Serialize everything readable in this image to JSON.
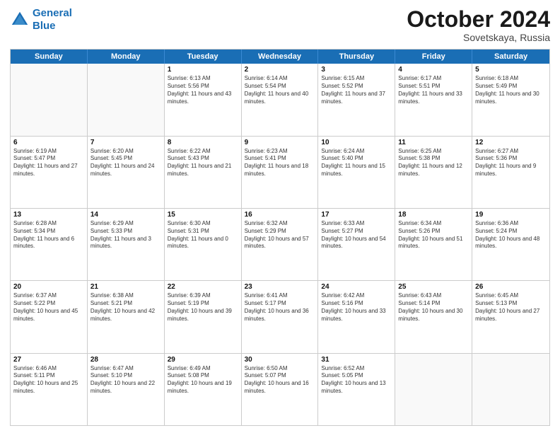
{
  "header": {
    "logo_line1": "General",
    "logo_line2": "Blue",
    "month": "October 2024",
    "location": "Sovetskaya, Russia"
  },
  "weekdays": [
    "Sunday",
    "Monday",
    "Tuesday",
    "Wednesday",
    "Thursday",
    "Friday",
    "Saturday"
  ],
  "rows": [
    [
      {
        "day": "",
        "sunrise": "",
        "sunset": "",
        "daylight": "",
        "empty": true
      },
      {
        "day": "",
        "sunrise": "",
        "sunset": "",
        "daylight": "",
        "empty": true
      },
      {
        "day": "1",
        "sunrise": "Sunrise: 6:13 AM",
        "sunset": "Sunset: 5:56 PM",
        "daylight": "Daylight: 11 hours and 43 minutes."
      },
      {
        "day": "2",
        "sunrise": "Sunrise: 6:14 AM",
        "sunset": "Sunset: 5:54 PM",
        "daylight": "Daylight: 11 hours and 40 minutes."
      },
      {
        "day": "3",
        "sunrise": "Sunrise: 6:15 AM",
        "sunset": "Sunset: 5:52 PM",
        "daylight": "Daylight: 11 hours and 37 minutes."
      },
      {
        "day": "4",
        "sunrise": "Sunrise: 6:17 AM",
        "sunset": "Sunset: 5:51 PM",
        "daylight": "Daylight: 11 hours and 33 minutes."
      },
      {
        "day": "5",
        "sunrise": "Sunrise: 6:18 AM",
        "sunset": "Sunset: 5:49 PM",
        "daylight": "Daylight: 11 hours and 30 minutes."
      }
    ],
    [
      {
        "day": "6",
        "sunrise": "Sunrise: 6:19 AM",
        "sunset": "Sunset: 5:47 PM",
        "daylight": "Daylight: 11 hours and 27 minutes."
      },
      {
        "day": "7",
        "sunrise": "Sunrise: 6:20 AM",
        "sunset": "Sunset: 5:45 PM",
        "daylight": "Daylight: 11 hours and 24 minutes."
      },
      {
        "day": "8",
        "sunrise": "Sunrise: 6:22 AM",
        "sunset": "Sunset: 5:43 PM",
        "daylight": "Daylight: 11 hours and 21 minutes."
      },
      {
        "day": "9",
        "sunrise": "Sunrise: 6:23 AM",
        "sunset": "Sunset: 5:41 PM",
        "daylight": "Daylight: 11 hours and 18 minutes."
      },
      {
        "day": "10",
        "sunrise": "Sunrise: 6:24 AM",
        "sunset": "Sunset: 5:40 PM",
        "daylight": "Daylight: 11 hours and 15 minutes."
      },
      {
        "day": "11",
        "sunrise": "Sunrise: 6:25 AM",
        "sunset": "Sunset: 5:38 PM",
        "daylight": "Daylight: 11 hours and 12 minutes."
      },
      {
        "day": "12",
        "sunrise": "Sunrise: 6:27 AM",
        "sunset": "Sunset: 5:36 PM",
        "daylight": "Daylight: 11 hours and 9 minutes."
      }
    ],
    [
      {
        "day": "13",
        "sunrise": "Sunrise: 6:28 AM",
        "sunset": "Sunset: 5:34 PM",
        "daylight": "Daylight: 11 hours and 6 minutes."
      },
      {
        "day": "14",
        "sunrise": "Sunrise: 6:29 AM",
        "sunset": "Sunset: 5:33 PM",
        "daylight": "Daylight: 11 hours and 3 minutes."
      },
      {
        "day": "15",
        "sunrise": "Sunrise: 6:30 AM",
        "sunset": "Sunset: 5:31 PM",
        "daylight": "Daylight: 11 hours and 0 minutes."
      },
      {
        "day": "16",
        "sunrise": "Sunrise: 6:32 AM",
        "sunset": "Sunset: 5:29 PM",
        "daylight": "Daylight: 10 hours and 57 minutes."
      },
      {
        "day": "17",
        "sunrise": "Sunrise: 6:33 AM",
        "sunset": "Sunset: 5:27 PM",
        "daylight": "Daylight: 10 hours and 54 minutes."
      },
      {
        "day": "18",
        "sunrise": "Sunrise: 6:34 AM",
        "sunset": "Sunset: 5:26 PM",
        "daylight": "Daylight: 10 hours and 51 minutes."
      },
      {
        "day": "19",
        "sunrise": "Sunrise: 6:36 AM",
        "sunset": "Sunset: 5:24 PM",
        "daylight": "Daylight: 10 hours and 48 minutes."
      }
    ],
    [
      {
        "day": "20",
        "sunrise": "Sunrise: 6:37 AM",
        "sunset": "Sunset: 5:22 PM",
        "daylight": "Daylight: 10 hours and 45 minutes."
      },
      {
        "day": "21",
        "sunrise": "Sunrise: 6:38 AM",
        "sunset": "Sunset: 5:21 PM",
        "daylight": "Daylight: 10 hours and 42 minutes."
      },
      {
        "day": "22",
        "sunrise": "Sunrise: 6:39 AM",
        "sunset": "Sunset: 5:19 PM",
        "daylight": "Daylight: 10 hours and 39 minutes."
      },
      {
        "day": "23",
        "sunrise": "Sunrise: 6:41 AM",
        "sunset": "Sunset: 5:17 PM",
        "daylight": "Daylight: 10 hours and 36 minutes."
      },
      {
        "day": "24",
        "sunrise": "Sunrise: 6:42 AM",
        "sunset": "Sunset: 5:16 PM",
        "daylight": "Daylight: 10 hours and 33 minutes."
      },
      {
        "day": "25",
        "sunrise": "Sunrise: 6:43 AM",
        "sunset": "Sunset: 5:14 PM",
        "daylight": "Daylight: 10 hours and 30 minutes."
      },
      {
        "day": "26",
        "sunrise": "Sunrise: 6:45 AM",
        "sunset": "Sunset: 5:13 PM",
        "daylight": "Daylight: 10 hours and 27 minutes."
      }
    ],
    [
      {
        "day": "27",
        "sunrise": "Sunrise: 6:46 AM",
        "sunset": "Sunset: 5:11 PM",
        "daylight": "Daylight: 10 hours and 25 minutes."
      },
      {
        "day": "28",
        "sunrise": "Sunrise: 6:47 AM",
        "sunset": "Sunset: 5:10 PM",
        "daylight": "Daylight: 10 hours and 22 minutes."
      },
      {
        "day": "29",
        "sunrise": "Sunrise: 6:49 AM",
        "sunset": "Sunset: 5:08 PM",
        "daylight": "Daylight: 10 hours and 19 minutes."
      },
      {
        "day": "30",
        "sunrise": "Sunrise: 6:50 AM",
        "sunset": "Sunset: 5:07 PM",
        "daylight": "Daylight: 10 hours and 16 minutes."
      },
      {
        "day": "31",
        "sunrise": "Sunrise: 6:52 AM",
        "sunset": "Sunset: 5:05 PM",
        "daylight": "Daylight: 10 hours and 13 minutes."
      },
      {
        "day": "",
        "sunrise": "",
        "sunset": "",
        "daylight": "",
        "empty": true
      },
      {
        "day": "",
        "sunrise": "",
        "sunset": "",
        "daylight": "",
        "empty": true
      }
    ]
  ]
}
